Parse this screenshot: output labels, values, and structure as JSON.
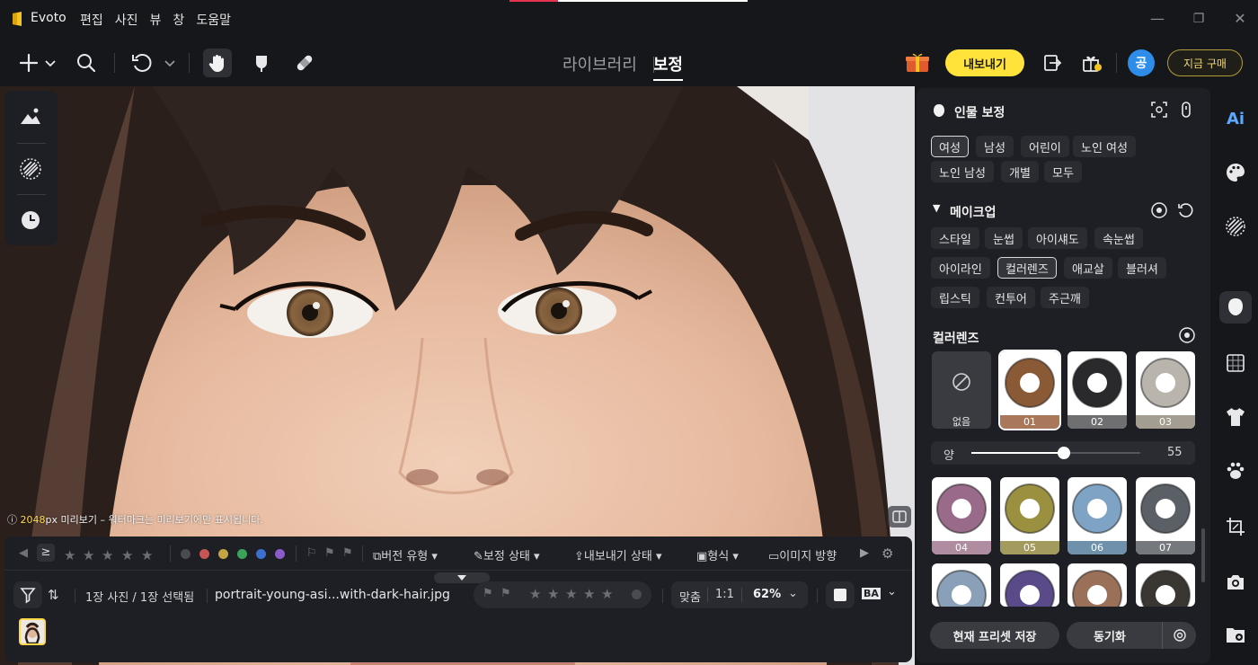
{
  "app": {
    "name": "Evoto"
  },
  "menu": [
    "편집",
    "사진",
    "뷰",
    "창",
    "도움말"
  ],
  "window_controls": {
    "minimize": "—",
    "restore": "❐",
    "close": "✕"
  },
  "toolbar": {
    "icons": [
      "add-icon",
      "chevron-down-icon",
      "search-icon",
      "undo-icon",
      "chevron-down-icon",
      "hand-icon",
      "brush-icon",
      "bandage-icon"
    ],
    "mode_tabs": [
      "라이브러리",
      "보정"
    ],
    "active_mode": "보정",
    "export_label": "내보내기",
    "avatar_letter": "공",
    "buy_label": "지금 구매"
  },
  "canvas": {
    "preview_prefix": "2048",
    "preview_note": "px 미리보기 – 워터마크는 미리보기에만 표시됩니다."
  },
  "bottom": {
    "filters": [
      "버전 유형",
      "보정 상태",
      "내보내기 상태",
      "형식",
      "이미지 방향"
    ],
    "ge_symbol": "≥",
    "photo_count": "1장 사진 / 1장 선택됨",
    "filename": "portrait-young-asi...with-dark-hair.jpg",
    "zoom": {
      "fit": "맞춤",
      "one_to_one": "1:1",
      "value": "62%"
    },
    "ba_label": "BA",
    "color_dots": [
      "#555555",
      "#d9534f",
      "#c8a43a",
      "#3aa35c",
      "#3b6fd0",
      "#8a5cc9"
    ]
  },
  "right_panel": {
    "title": "인물 보정",
    "subjects": [
      "여성",
      "남성",
      "어린이",
      "노인 여성",
      "노인 남성",
      "개별",
      "모두"
    ],
    "selected_subject": "여성",
    "makeup_title": "메이크업",
    "makeup_items": [
      "스타일",
      "눈썹",
      "아이섀도",
      "속눈썹",
      "아이라인",
      "컬러렌즈",
      "애교살",
      "블러셔",
      "립스틱",
      "컨투어",
      "주근깨"
    ],
    "selected_makeup": "컬러렌즈",
    "lens_title": "컬러렌즈",
    "none_label": "없음",
    "lenses": [
      {
        "label": "01",
        "iris": "#8a5a36",
        "band": "#a9785a"
      },
      {
        "label": "02",
        "iris": "#2a2a2c",
        "band": "#6f6f72"
      },
      {
        "label": "03",
        "iris": "#b9b5ad",
        "band": "#a39e91"
      },
      {
        "label": "04",
        "iris": "#9a6a8a",
        "band": "#b08ca0"
      },
      {
        "label": "05",
        "iris": "#9a9040",
        "band": "#a39b5d"
      },
      {
        "label": "06",
        "iris": "#7ea3c4",
        "band": "#6f91ab"
      },
      {
        "label": "07",
        "iris": "#5a6066",
        "band": "#75787c"
      },
      {
        "label": "",
        "iris": "#8aa0b8",
        "band": "#7e8fa2"
      },
      {
        "label": "",
        "iris": "#5a4a8a",
        "band": "#6e6090"
      },
      {
        "label": "",
        "iris": "#9a7058",
        "band": "#97735e"
      },
      {
        "label": "",
        "iris": "#3a3632",
        "band": "#5a5650"
      }
    ],
    "selected_lens": "01",
    "amount_label": "양",
    "amount_value": "55",
    "amount_fraction": 0.55,
    "save_label": "현재 프리셋 저장",
    "sync_label": "동기화"
  },
  "far_right": [
    "ai-icon",
    "palette-icon",
    "texture-icon",
    "face-icon",
    "background-icon",
    "clothing-icon",
    "pet-icon",
    "crop-icon",
    "camera-icon",
    "folder-icon"
  ],
  "colors": {
    "accent": "#ffe33a",
    "brand_avatar": "#2e8de8"
  }
}
